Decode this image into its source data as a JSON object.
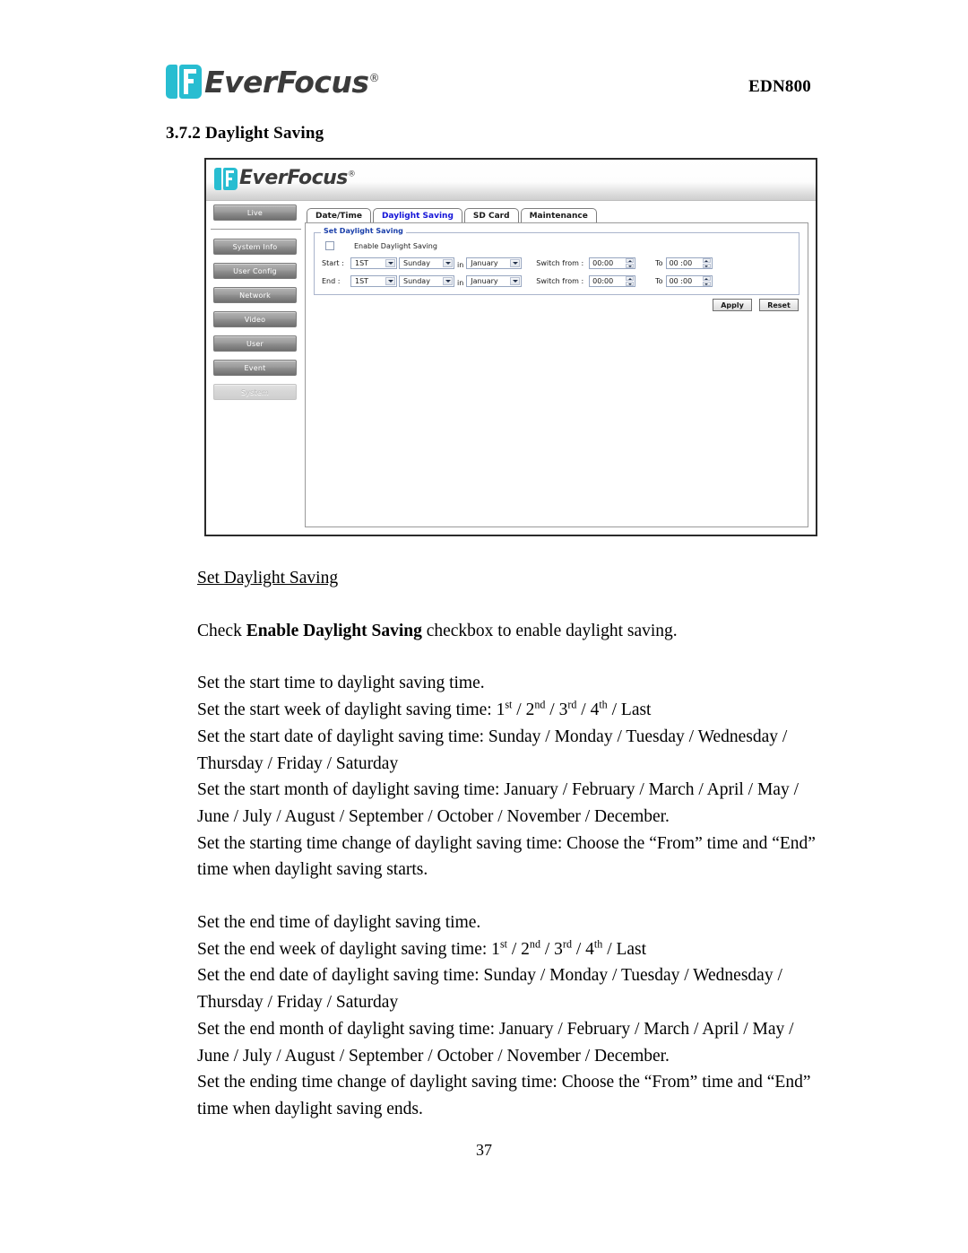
{
  "document": {
    "brand": "EverFocus",
    "brand_registered": "®",
    "model": "EDN800",
    "section_number": "3.7.2",
    "section_title": "Daylight Saving",
    "heading": "3.7.2 Daylight Saving",
    "page_number": "37"
  },
  "screenshot": {
    "app_brand": "EverFocus",
    "app_brand_registered": "®",
    "sidebar": {
      "items": [
        {
          "label": "Live",
          "active": false
        },
        {
          "label": "System Info",
          "active": false
        },
        {
          "label": "User Config",
          "active": false
        },
        {
          "label": "Network",
          "active": false
        },
        {
          "label": "Video",
          "active": false
        },
        {
          "label": "User",
          "active": false
        },
        {
          "label": "Event",
          "active": false
        },
        {
          "label": "System",
          "active": true
        }
      ]
    },
    "tabs": [
      {
        "label": "Date/Time",
        "active": false
      },
      {
        "label": "Daylight Saving",
        "active": true
      },
      {
        "label": "SD Card",
        "active": false
      },
      {
        "label": "Maintenance",
        "active": false
      }
    ],
    "form": {
      "legend": "Set Daylight Saving",
      "enable_checkbox_label": "Enable Daylight Saving",
      "enable_checkbox_checked": false,
      "in_word": "in",
      "switch_from_label": "Switch from :",
      "to_label": "To",
      "rows": [
        {
          "label": "Start :",
          "week": "1ST",
          "day": "Sunday",
          "month": "January",
          "switch_from": "00:00",
          "switch_to": "00 :00"
        },
        {
          "label": "End :",
          "week": "1ST",
          "day": "Sunday",
          "month": "January",
          "switch_from": "00:00",
          "switch_to": "00 :00"
        }
      ],
      "apply_label": "Apply",
      "reset_label": "Reset"
    },
    "colors": {
      "brand_cyan": "#28bdd1",
      "active_tab_text": "#1414d8",
      "legend_text": "#1a3faa",
      "nav_button": "#8e8e8e"
    }
  },
  "body": {
    "subheading": "Set Daylight Saving",
    "intro_prefix": "Check ",
    "intro_bold": "Enable Daylight Saving",
    "intro_suffix": " checkbox to enable daylight saving.",
    "start_block": {
      "line1": "Set the start time to daylight saving time.",
      "line2_prefix": "Set the start week of daylight saving time: 1",
      "line2_sup1": "st",
      "line2_mid1": " / 2",
      "line2_sup2": "nd",
      "line2_mid2": " / 3",
      "line2_sup3": "rd",
      "line2_mid3": " / 4",
      "line2_sup4": "th",
      "line2_suffix": " / Last",
      "line3": "Set the start date of daylight saving time: Sunday / Monday / Tuesday / Wednesday / Thursday / Friday / Saturday",
      "line4": "Set the start month of daylight saving time: January / February / March / April / May / June / July / August / September / October / November / December.",
      "line5": "Set the starting time change of daylight saving time: Choose the “From” time and “End” time when daylight saving starts."
    },
    "end_block": {
      "line1": "Set the end time of daylight saving time.",
      "line2_prefix": "Set the end week of daylight saving time: 1",
      "line2_sup1": "st",
      "line2_mid1": " / 2",
      "line2_sup2": "nd",
      "line2_mid2": " / 3",
      "line2_sup3": "rd",
      "line2_mid3": " / 4",
      "line2_sup4": "th",
      "line2_suffix": " / Last",
      "line3": "Set the end date of daylight saving time:  Sunday / Monday / Tuesday / Wednesday / Thursday / Friday / Saturday",
      "line4": "Set the end month of daylight saving time: January / February / March / April / May / June / July / August / September / October / November / December.",
      "line5": "Set the ending time change of daylight saving time: Choose the “From” time and “End” time when daylight saving ends."
    }
  }
}
